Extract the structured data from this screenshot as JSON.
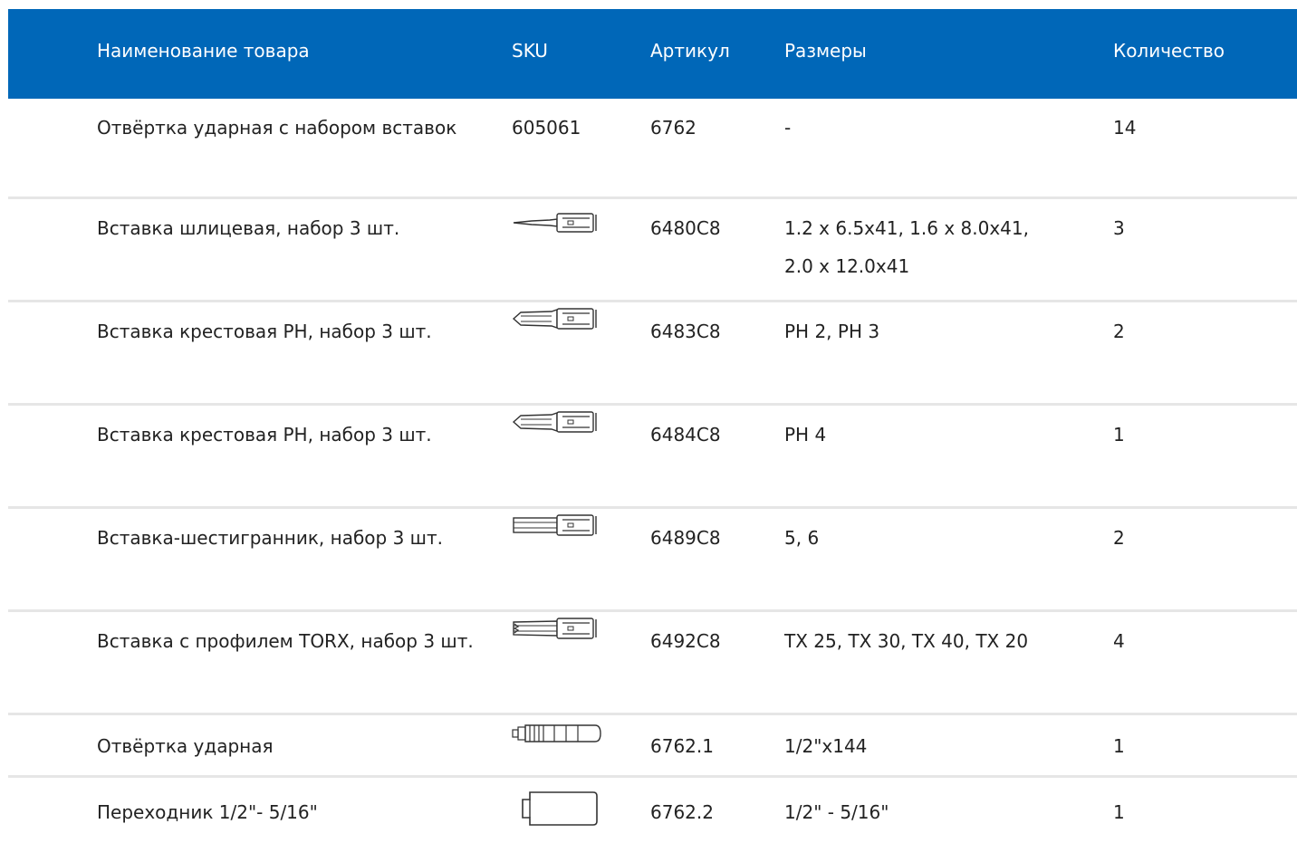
{
  "table": {
    "columns": {
      "name": "Наименование товара",
      "sku": "SKU",
      "article": "Артикул",
      "sizes": "Размеры",
      "quantity": "Количество"
    },
    "rows": [
      {
        "name": "Отвёртка ударная с набором вставок",
        "sku": "605061",
        "sku_icon": "",
        "article": "6762",
        "sizes": "-",
        "quantity": "14"
      },
      {
        "name": "Вставка шлицевая, набор 3 шт.",
        "sku": "",
        "sku_icon": "slotted-bit-icon",
        "article": "6480C8",
        "sizes": "1.2 x 6.5x41, 1.6 x 8.0x41, 2.0 x 12.0x41",
        "quantity": "3"
      },
      {
        "name": "Вставка крестовая PH, набор 3 шт.",
        "sku": "",
        "sku_icon": "phillips-bit-icon",
        "article": "6483C8",
        "sizes": "PH 2, PH 3",
        "quantity": "2"
      },
      {
        "name": "Вставка крестовая PH, набор 3 шт.",
        "sku": "",
        "sku_icon": "phillips-bit-icon",
        "article": "6484C8",
        "sizes": "PH 4",
        "quantity": "1"
      },
      {
        "name": "Вставка-шестигранник, набор 3 шт.",
        "sku": "",
        "sku_icon": "hex-bit-icon",
        "article": "6489C8",
        "sizes": "5, 6",
        "quantity": "2"
      },
      {
        "name": "Вставка с профилем TORX, набор 3 шт.",
        "sku": "",
        "sku_icon": "torx-bit-icon",
        "article": "6492C8",
        "sizes": "TX 25, TX 30, TX 40, TX 20",
        "quantity": "4"
      },
      {
        "name": "Отвёртка ударная",
        "sku": "",
        "sku_icon": "impact-driver-icon",
        "article": "6762.1",
        "sizes": "1/2\"x144",
        "quantity": "1"
      },
      {
        "name": "Переходник 1/2\"- 5/16\"",
        "sku": "",
        "sku_icon": "adapter-icon",
        "article": "6762.2",
        "sizes": "1/2\" - 5/16\"",
        "quantity": "1"
      }
    ]
  },
  "colors": {
    "header_bg": "#0067b8",
    "header_text": "#ffffff",
    "divider": "#e6e6e6"
  }
}
